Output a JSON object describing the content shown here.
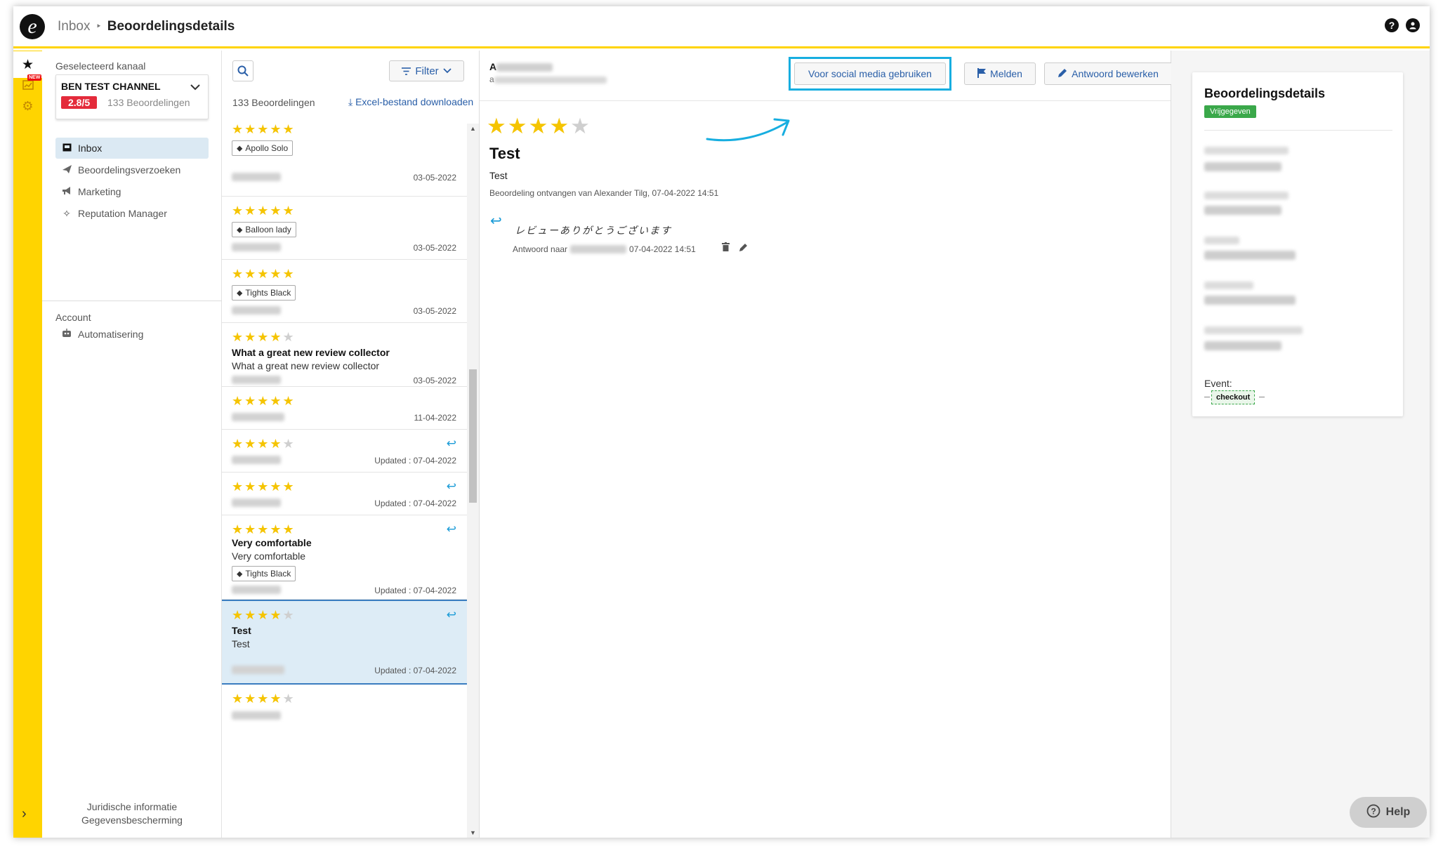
{
  "header": {
    "logo_letter": "e",
    "breadcrumb_root": "Inbox",
    "breadcrumb_sep": "‣",
    "breadcrumb_current": "Beoordelingsdetails",
    "help_icon": "?",
    "user_icon": "●"
  },
  "sidebar": {
    "selected_channel_label": "Geselecteerd kanaal",
    "channel_name": "BEN TEST CHANNEL",
    "channel_rating": "2.8/5",
    "channel_reviews": "133 Beoordelingen",
    "nav": [
      {
        "label": "Inbox",
        "icon": "inbox-icon"
      },
      {
        "label": "Beoordelingsverzoeken",
        "icon": "paper-plane-icon"
      },
      {
        "label": "Marketing",
        "icon": "megaphone-icon"
      },
      {
        "label": "Reputation Manager",
        "icon": "sparkle-icon"
      }
    ],
    "account_label": "Account",
    "account_nav": [
      {
        "label": "Automatisering",
        "icon": "robot-icon"
      }
    ],
    "footer_legal": "Juridische informatie",
    "footer_privacy": "Gegevensbescherming"
  },
  "rail": {
    "new_badge": "NEW"
  },
  "list": {
    "filter_label": "Filter",
    "count_label": "133 Beoordelingen",
    "excel_label": "Excel-bestand downloaden",
    "reviews": [
      {
        "stars": 5,
        "tag": "Apollo Solo",
        "date": "03-05-2022"
      },
      {
        "stars": 5,
        "tag": "Balloon lady",
        "date": "03-05-2022"
      },
      {
        "stars": 5,
        "tag": "Tights Black",
        "date": "03-05-2022"
      },
      {
        "stars": 4,
        "title": "What a great new review collector",
        "body": "What a great new review collector",
        "date": "03-05-2022"
      },
      {
        "stars": 5,
        "date": "11-04-2022"
      },
      {
        "stars": 4,
        "date": "Updated : 07-04-2022",
        "replied": true
      },
      {
        "stars": 5,
        "date": "Updated : 07-04-2022",
        "replied": true
      },
      {
        "stars": 5,
        "title": "Very comfortable",
        "body": "Very comfortable",
        "tag": "Tights Black",
        "date": "Updated : 07-04-2022",
        "replied": true
      },
      {
        "stars": 4,
        "title": "Test",
        "body": "Test",
        "date": "Updated : 07-04-2022",
        "replied": true,
        "selected": true
      },
      {
        "stars": 4
      }
    ]
  },
  "detail": {
    "reviewer_initial": "A",
    "reviewer_email_initial": "a",
    "btn_social": "Voor social media gebruiken",
    "btn_report": "Melden",
    "btn_edit": "Antwoord bewerken",
    "stars": 4,
    "title": "Test",
    "body": "Test",
    "meta": "Beoordeling ontvangen van Alexander Tilg, 07-04-2022 14:51",
    "reply_text": "レビューありがとうございます",
    "reply_meta_prefix": "Antwoord naar",
    "reply_meta_date": "07-04-2022 14:51"
  },
  "rpanel": {
    "title": "Beoordelingsdetails",
    "status_badge": "Vrijgegeven",
    "event_label": "Event:",
    "event_chip": "checkout"
  },
  "help": {
    "label": "Help"
  },
  "colors": {
    "accent_yellow": "#ffd400",
    "link_blue": "#2a5fa8",
    "highlight_cyan": "#17aee0",
    "rating_red": "#e42b3b",
    "status_green": "#3aa84a"
  }
}
